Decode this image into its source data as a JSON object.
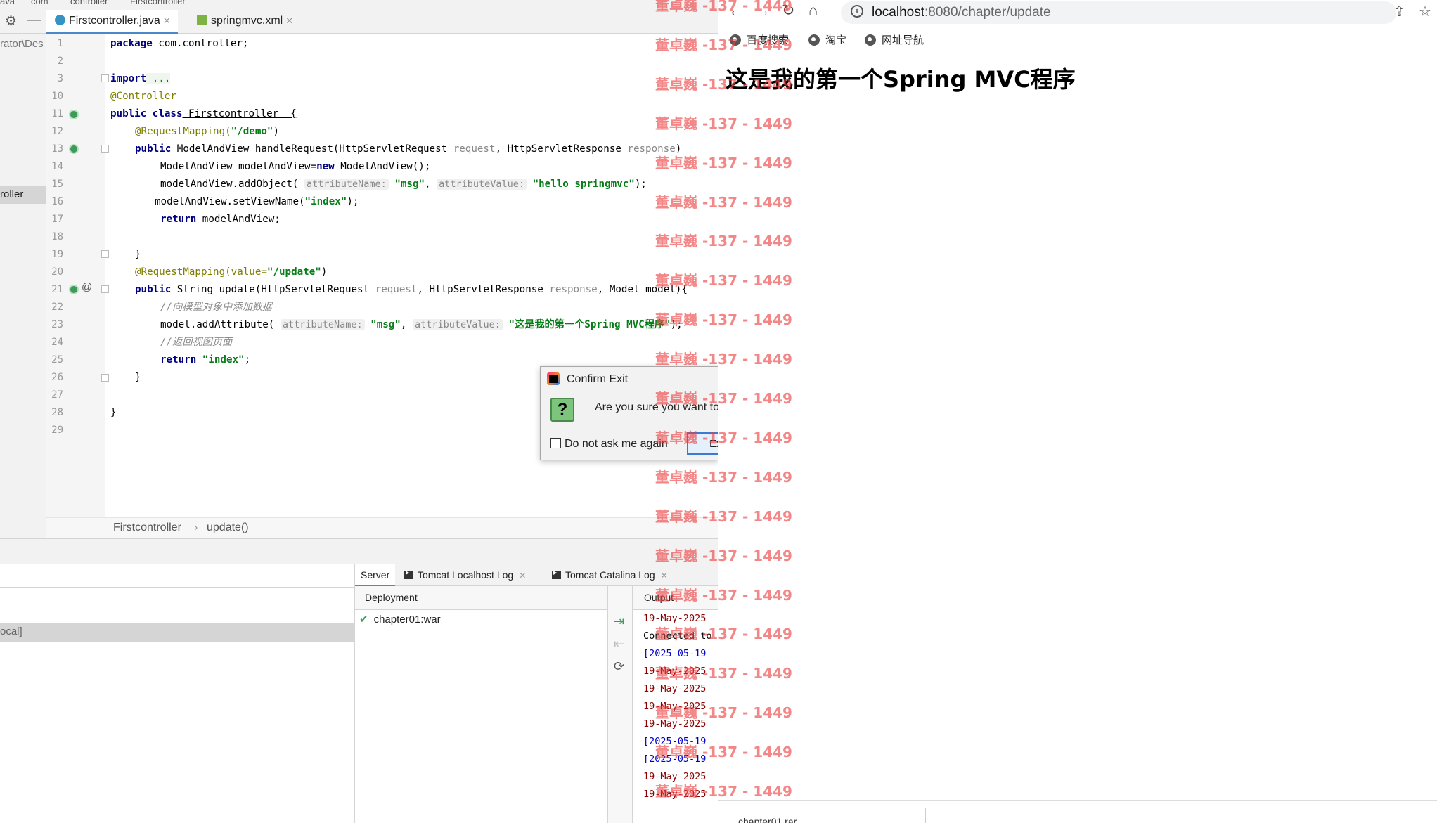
{
  "ide": {
    "top_crumbs": [
      "ava",
      "com",
      "controller",
      "Firstcontroller"
    ],
    "project_fragments": {
      "path": "rator\\Des",
      "selected": "roller"
    },
    "tabs": [
      {
        "label": "Firstcontroller.java",
        "icon": "java-class-icon",
        "active": true
      },
      {
        "label": "springmvc.xml",
        "icon": "xml-file-icon",
        "active": false
      }
    ],
    "code_lines": [
      {
        "n": "1"
      },
      {
        "n": "2"
      },
      {
        "n": "3"
      },
      {
        "n": "10"
      },
      {
        "n": "11"
      },
      {
        "n": "12"
      },
      {
        "n": "13"
      },
      {
        "n": "14"
      },
      {
        "n": "15"
      },
      {
        "n": "16"
      },
      {
        "n": "17"
      },
      {
        "n": "18"
      },
      {
        "n": "19"
      },
      {
        "n": "20"
      },
      {
        "n": "21"
      },
      {
        "n": "22"
      },
      {
        "n": "23"
      },
      {
        "n": "24"
      },
      {
        "n": "25"
      },
      {
        "n": "26"
      },
      {
        "n": "27"
      },
      {
        "n": "28"
      },
      {
        "n": "29"
      }
    ],
    "code": {
      "l1_kw": "package",
      "l1_rest": " com.controller;",
      "l3_kw": "import",
      "l3_rest": " ...",
      "l10_ann": "@Controller",
      "l11_kw": "public class",
      "l11_rest": " Firstcontroller  {",
      "l12_ann": "@RequestMapping(",
      "l12_str": "\"/demo\"",
      "l12_end": ")",
      "l13_kw": "public",
      "l13_a": " ModelAndView handleRequest(HttpServletRequest ",
      "l13_p1": "request",
      "l13_b": ", HttpServletResponse ",
      "l13_p2": "response",
      "l13_end": ")",
      "l14_a": "ModelAndView modelAndView=",
      "l14_kw": "new",
      "l14_b": " ModelAndView();",
      "l15_a": "modelAndView.addObject( ",
      "l15_h1": "attributeName:",
      "l15_s1": " \"msg\"",
      "l15_b": ", ",
      "l15_h2": "attributeValue:",
      "l15_s2": " \"hello springmvc\"",
      "l15_end": ");",
      "l16_a": "modelAndView.setViewName(",
      "l16_s": "\"index\"",
      "l16_end": ");",
      "l17_kw": "return",
      "l17_rest": " modelAndView;",
      "l19": "}",
      "l20_ann": "@RequestMapping(value=",
      "l20_str": "\"/update\"",
      "l20_end": ")",
      "l21_kw": "public",
      "l21_a": " String update(HttpServletRequest ",
      "l21_p1": "request",
      "l21_b": ", HttpServletResponse ",
      "l21_p2": "response",
      "l21_c": ", Model model){",
      "l22_cm": "//向模型对象中添加数据",
      "l23_a": "model.addAttribute( ",
      "l23_h1": "attributeName:",
      "l23_s1": " \"msg\"",
      "l23_b": ", ",
      "l23_h2": "attributeValue:",
      "l23_s2": " \"这是我的第一个Spring MVC程序\"",
      "l23_end": ");",
      "l24_cm": "//返回视图页面",
      "l25_kw": "return",
      "l25_s": " \"index\"",
      "l25_end": ";",
      "l26": "}",
      "l28": "}"
    },
    "breadcrumb": {
      "class": "Firstcontroller",
      "sep": "›",
      "method": "update()"
    },
    "services": {
      "left_selected": "ocal]",
      "tabs": [
        {
          "label": "Server",
          "active": true
        },
        {
          "label": "Tomcat Localhost Log"
        },
        {
          "label": "Tomcat Catalina Log"
        }
      ],
      "deployment_header": "Deployment",
      "deployment_item": "chapter01:war",
      "output_header": "Output",
      "output_lines": [
        {
          "text": "19-May-2025",
          "color": "#8b0000"
        },
        {
          "text": "Connected to",
          "color": "#000000"
        },
        {
          "text": "[2025-05-19",
          "color": "#0000cc"
        },
        {
          "text": "19-May-2025",
          "color": "#8b0000"
        },
        {
          "text": "19-May-2025",
          "color": "#8b0000"
        },
        {
          "text": "19-May-2025",
          "color": "#8b0000"
        },
        {
          "text": "19-May-2025",
          "color": "#8b0000"
        },
        {
          "text": "[2025-05-19",
          "color": "#0000cc"
        },
        {
          "text": "[2025-05-19",
          "color": "#0000cc"
        },
        {
          "text": "19-May-2025",
          "color": "#8b0000"
        },
        {
          "text": "19-May-2025",
          "color": "#8b0000"
        }
      ]
    }
  },
  "dialog": {
    "title": "Confirm Exit",
    "message": "Are you sure you want to",
    "checkbox_label": "Do not ask me again",
    "exit_label": "Exit"
  },
  "browser": {
    "url_host": "localhost",
    "url_path": ":8080/chapter/update",
    "bookmarks": [
      "百度搜索",
      "淘宝",
      "网址导航"
    ],
    "heading": "这是我的第一个Spring MVC程序",
    "download_item": "chapter01.rar"
  },
  "watermark": {
    "text": "董卓巍 -137 - 1449",
    "color": "#eb3c3c",
    "count": 21
  }
}
